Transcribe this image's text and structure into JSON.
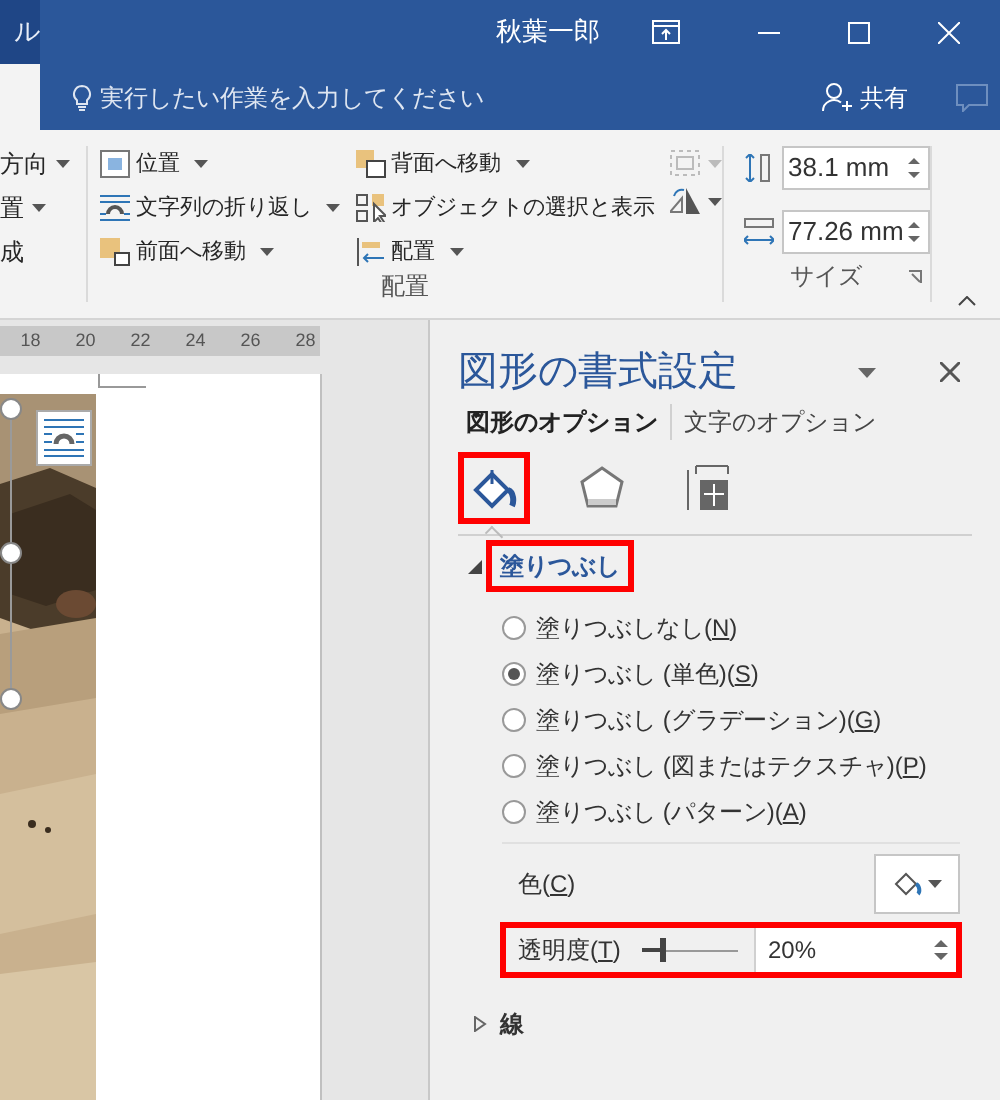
{
  "window": {
    "partial_tab": "ル",
    "user": "秋葉一郎"
  },
  "tell_me": {
    "placeholder": "実行したい作業を入力してください"
  },
  "share_button": "共有",
  "ribbon": {
    "partial_items": [
      {
        "label": "方向",
        "dropdown": true
      },
      {
        "label": "置",
        "dropdown": true
      },
      {
        "label": "成",
        "dropdown": false
      }
    ],
    "arrange": {
      "label": "配置",
      "columns": [
        [
          {
            "label": "位置",
            "dropdown": true
          },
          {
            "label": "文字列の折り返し",
            "dropdown": true
          },
          {
            "label": "前面へ移動",
            "dropdown": true
          }
        ],
        [
          {
            "label": "背面へ移動",
            "dropdown": true
          },
          {
            "label": "オブジェクトの選択と表示",
            "dropdown": false
          },
          {
            "label": "配置",
            "dropdown": true
          }
        ]
      ]
    },
    "size": {
      "label": "サイズ",
      "height": "38.1 mm",
      "width": "77.26 mm"
    }
  },
  "ruler": [
    "18",
    "20",
    "22",
    "24",
    "26",
    "28"
  ],
  "pane": {
    "title": "図形の書式設定",
    "tabs": [
      {
        "label": "図形のオプション",
        "selected": true
      },
      {
        "label": "文字のオプション",
        "selected": false
      }
    ],
    "icon_tabs": [
      {
        "selected": true,
        "highlighted": true
      },
      {
        "selected": false,
        "highlighted": false
      },
      {
        "selected": false,
        "highlighted": false
      }
    ],
    "fill": {
      "label": "塗りつぶし",
      "expanded": true,
      "highlighted": true,
      "options": [
        {
          "before": "塗りつぶしなし(",
          "key": "N",
          "after": ")",
          "selected": false
        },
        {
          "before": "塗りつぶし (単色)(",
          "key": "S",
          "after": ")",
          "selected": true
        },
        {
          "before": "塗りつぶし (グラデーション)(",
          "key": "G",
          "after": ")",
          "selected": false
        },
        {
          "before": "塗りつぶし (図またはテクスチャ)(",
          "key": "P",
          "after": ")",
          "selected": false
        },
        {
          "before": "塗りつぶし (パターン)(",
          "key": "A",
          "after": ")",
          "selected": false
        }
      ],
      "color": {
        "before": "色(",
        "key": "C",
        "after": ")"
      },
      "transparency": {
        "before": "透明度(",
        "key": "T",
        "after": ")",
        "level": 0.2,
        "value": "20%",
        "highlighted": true
      }
    },
    "line": {
      "label": "線",
      "expanded": false
    }
  }
}
